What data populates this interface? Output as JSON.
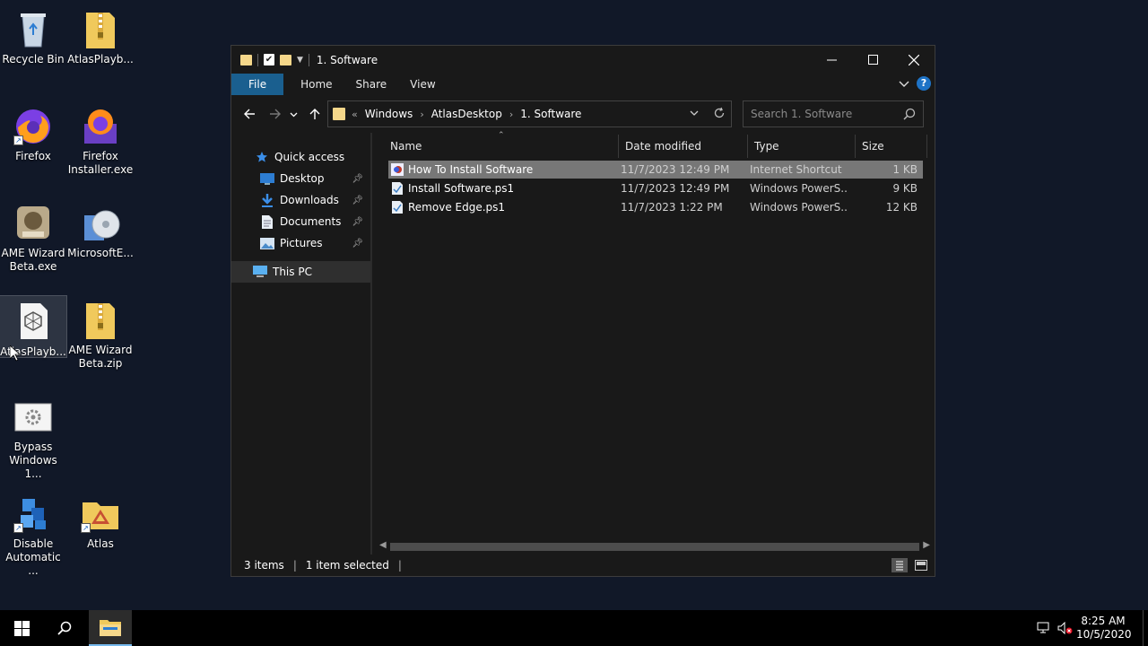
{
  "desktop": {
    "icons": [
      {
        "label": "Recycle Bin",
        "icon": "recycle-bin-icon"
      },
      {
        "label": "AtlasPlayb...",
        "icon": "zip-folder-icon"
      },
      {
        "label": "Firefox",
        "icon": "firefox-icon"
      },
      {
        "label": "Firefox Installer.exe",
        "icon": "firefox-installer-icon"
      },
      {
        "label": "AME Wizard Beta.exe",
        "icon": "ame-wizard-icon"
      },
      {
        "label": "MicrosoftE...",
        "icon": "installer-disc-icon"
      },
      {
        "label": "AtlasPlayb...",
        "icon": "atlas-playbook-icon"
      },
      {
        "label": "AME Wizard Beta.zip",
        "icon": "zip-folder-icon"
      },
      {
        "label": "Bypass Windows 1...",
        "icon": "settings-file-icon"
      },
      {
        "label": "Disable Automatic ...",
        "icon": "registry-icon"
      },
      {
        "label": "Atlas",
        "icon": "atlas-folder-icon"
      }
    ]
  },
  "window": {
    "title": "1. Software",
    "controls": {
      "minimize": "—",
      "maximize": "☐",
      "close": "✕"
    }
  },
  "ribbon": {
    "tabs": [
      "File",
      "Home",
      "Share",
      "View"
    ]
  },
  "address": {
    "overflow": "«",
    "crumbs": [
      "Windows",
      "AtlasDesktop",
      "1. Software"
    ],
    "search_placeholder": "Search 1. Software"
  },
  "navpane": {
    "quick_access": "Quick access",
    "items": [
      {
        "label": "Desktop",
        "icon": "desktop-icon",
        "pinned": true
      },
      {
        "label": "Downloads",
        "icon": "downloads-icon",
        "pinned": true
      },
      {
        "label": "Documents",
        "icon": "documents-icon",
        "pinned": true
      },
      {
        "label": "Pictures",
        "icon": "pictures-icon",
        "pinned": true
      }
    ],
    "this_pc": "This PC"
  },
  "files": {
    "columns": [
      "Name",
      "Date modified",
      "Type",
      "Size"
    ],
    "rows": [
      {
        "name": "How To Install Software",
        "date": "11/7/2023 12:49 PM",
        "type": "Internet Shortcut",
        "size": "1 KB",
        "selected": true
      },
      {
        "name": "Install Software.ps1",
        "date": "11/7/2023 12:49 PM",
        "type": "Windows PowerS...",
        "size": "9 KB",
        "selected": false
      },
      {
        "name": "Remove Edge.ps1",
        "date": "11/7/2023 1:22 PM",
        "type": "Windows PowerS...",
        "size": "12 KB",
        "selected": false
      }
    ]
  },
  "status": {
    "count": "3 items",
    "selected": "1 item selected"
  },
  "taskbar": {
    "time": "8:25 AM",
    "date": "10/5/2020"
  },
  "colors": {
    "file_tab": "#1a5f8f",
    "selection": "#777777",
    "folder": "#f5d78a"
  }
}
